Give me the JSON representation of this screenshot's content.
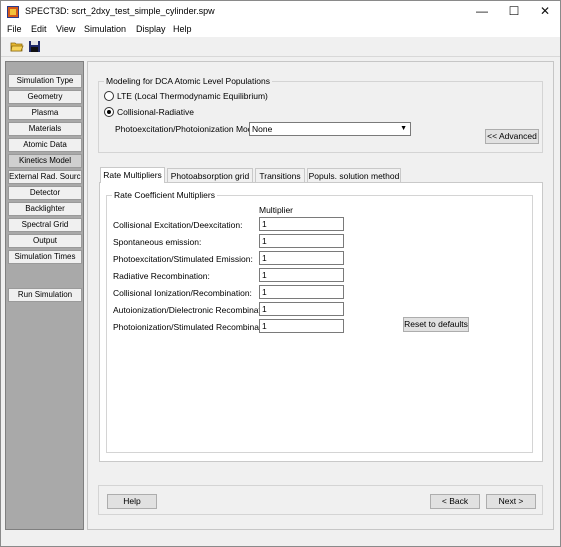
{
  "window": {
    "title": "SPECT3D:  scrt_2dxy_test_simple_cylinder.spw",
    "minimize": "—",
    "maximize": "☐",
    "close": "✕"
  },
  "menu": [
    "File",
    "Edit",
    "View",
    "Simulation",
    "Display",
    "Help"
  ],
  "toolbar": {
    "icons": [
      "open-folder-icon",
      "save-icon"
    ]
  },
  "sidebar": {
    "items": [
      "Simulation Type",
      "Geometry",
      "Plasma",
      "Materials",
      "Atomic Data",
      "Kinetics Model",
      "External Rad. Source",
      "Detector",
      "Backlighter",
      "Spectral Grid",
      "Output",
      "Simulation Times"
    ],
    "active": "Kinetics Model",
    "run": "Run Simulation"
  },
  "modeling": {
    "group_title": "Modeling for DCA Atomic Level Populations",
    "lte_label": "LTE (Local Thermodynamic Equilibrium)",
    "cr_label": "Collisional-Radiative",
    "selected": "Collisional-Radiative",
    "photo_model_label": "Photoexcitation/Photoionization Model:",
    "photo_model_value": "None",
    "advanced_button": "<< Advanced"
  },
  "tabs": [
    "Rate Multipliers",
    "Photoabsorption grid",
    "Transitions",
    "Populs. solution method"
  ],
  "active_tab": "Rate Multipliers",
  "rates": {
    "group_title": "Rate Coefficient Multipliers",
    "column_header": "Multiplier",
    "rows": [
      {
        "label": "Collisional Excitation/Deexcitation:",
        "value": "1"
      },
      {
        "label": "Spontaneous emission:",
        "value": "1"
      },
      {
        "label": "Photoexcitation/Stimulated Emission:",
        "value": "1"
      },
      {
        "label": "Radiative Recombination:",
        "value": "1"
      },
      {
        "label": "Collisional Ionization/Recombination:",
        "value": "1"
      },
      {
        "label": "Autoionization/Dielectronic Recombination:",
        "value": "1"
      },
      {
        "label": "Photoionization/Stimulated Recombination:",
        "value": "1"
      }
    ],
    "reset_button": "Reset to defaults"
  },
  "footer": {
    "help": "Help",
    "back": "< Back",
    "next": "Next >"
  },
  "colors": {
    "sidebar_bg": "#a9a9a9",
    "window_bg": "#f0f0f0",
    "icon_folder": "#e8b830",
    "icon_app": "#d45a1a"
  }
}
